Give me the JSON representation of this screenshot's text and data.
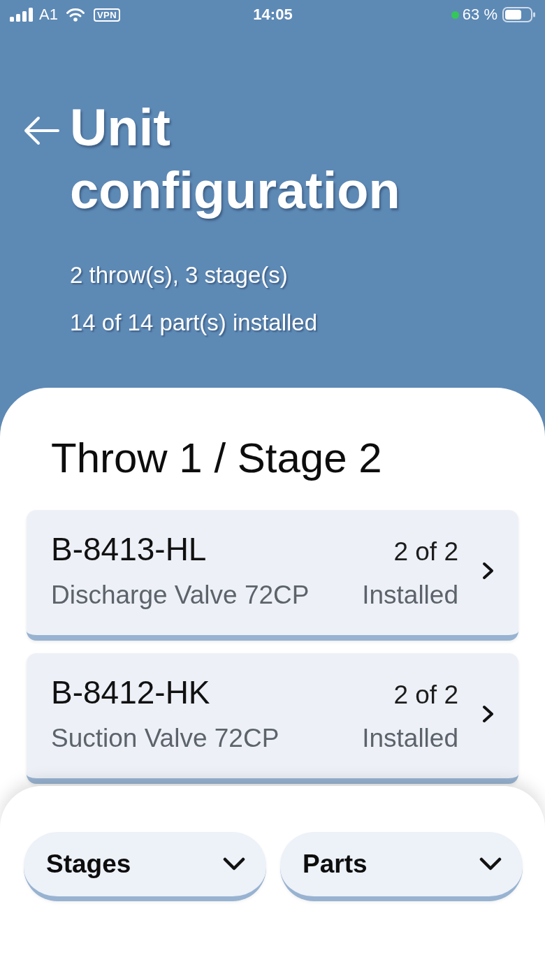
{
  "status_bar": {
    "carrier": "A1",
    "vpn": "VPN",
    "time": "14:05",
    "battery": "63 %"
  },
  "header": {
    "title": "Unit configuration",
    "summary": [
      "2 throw(s), 3 stage(s)",
      "14 of 14 part(s) installed"
    ]
  },
  "section": {
    "title": "Throw 1 / Stage 2",
    "parts": [
      {
        "part_number": "B-8413-HL",
        "name": "Discharge Valve 72CP",
        "count": "2 of 2",
        "status": "Installed"
      },
      {
        "part_number": "B-8412-HK",
        "name": "Suction Valve 72CP",
        "count": "2 of 2",
        "status": "Installed"
      }
    ]
  },
  "filters": [
    {
      "label": "Stages"
    },
    {
      "label": "Parts"
    }
  ]
}
